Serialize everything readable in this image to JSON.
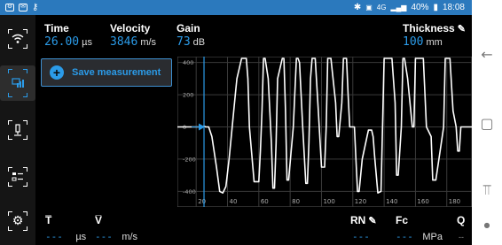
{
  "status_bar": {
    "left_icons": [
      "notification-icon",
      "mail-icon",
      "key-icon"
    ],
    "network": "4G",
    "battery": "40%",
    "time": "18:08"
  },
  "header": {
    "time": {
      "label": "Time",
      "value": "26.00",
      "unit": "µs"
    },
    "velocity": {
      "label": "Velocity",
      "value": "3846",
      "unit": "m/s"
    },
    "gain": {
      "label": "Gain",
      "value": "73",
      "unit": "dB"
    },
    "thickness": {
      "label": "Thickness",
      "value": "100",
      "unit": "mm"
    }
  },
  "save_button": {
    "label": "Save measurement"
  },
  "sidebar": {
    "items": [
      "wifi-icon",
      "ascan-view-icon",
      "probe-icon",
      "settings-list-icon",
      "gear-icon"
    ],
    "active_index": 1
  },
  "chart_data": {
    "type": "line",
    "xlabel": "",
    "ylabel": "",
    "xlim": [
      8,
      196
    ],
    "ylim": [
      -420,
      420
    ],
    "x_ticks": [
      "20",
      "40",
      "60",
      "80",
      "100",
      "120",
      "140",
      "160",
      "180"
    ],
    "y_ticks": [
      "400",
      "200",
      "0",
      "-200",
      "-400"
    ],
    "grid": true,
    "gate_x": 25,
    "series": [
      {
        "color": "#ffffff",
        "x": [
          8,
          22,
          24,
          25,
          26,
          28,
          30,
          33,
          35,
          37,
          39,
          41,
          43,
          45,
          46,
          49,
          52,
          53,
          54,
          57,
          60,
          61,
          62,
          63,
          64,
          66,
          68,
          69,
          70,
          71,
          72,
          75,
          76,
          77,
          78,
          79,
          82,
          84,
          85,
          86,
          88,
          90,
          91,
          92,
          93,
          94,
          96,
          98,
          100,
          102,
          103,
          104,
          106,
          109,
          110,
          111,
          113,
          114,
          116,
          117,
          118,
          121,
          122,
          123,
          124,
          126,
          130,
          132,
          133,
          134,
          136,
          138,
          139,
          140,
          142,
          145,
          147,
          148,
          149,
          151,
          152,
          153,
          155,
          158,
          159,
          160,
          162,
          165,
          167,
          168,
          170,
          171,
          173,
          178,
          179,
          180,
          182,
          184,
          186,
          187,
          188,
          189,
          190,
          191,
          192,
          196
        ],
        "y": [
          0,
          0,
          0,
          5,
          0,
          0,
          -60,
          -250,
          -400,
          -410,
          -370,
          -200,
          0,
          200,
          300,
          520,
          520,
          300,
          0,
          -340,
          -340,
          -150,
          100,
          520,
          520,
          300,
          -100,
          -380,
          -380,
          -100,
          300,
          520,
          520,
          100,
          -330,
          -330,
          0,
          520,
          520,
          400,
          0,
          -350,
          -350,
          -100,
          300,
          520,
          520,
          100,
          -250,
          -250,
          0,
          520,
          520,
          150,
          -60,
          -60,
          150,
          520,
          520,
          200,
          0,
          0,
          -200,
          -400,
          -400,
          -200,
          -20,
          -20,
          -60,
          -190,
          -410,
          -400,
          0,
          520,
          520,
          520,
          150,
          -300,
          -300,
          0,
          520,
          520,
          300,
          0,
          0,
          520,
          520,
          520,
          0,
          -20,
          -60,
          -330,
          -330,
          0,
          520,
          520,
          520,
          100,
          0,
          -150,
          -150,
          0,
          0,
          0,
          0,
          0
        ]
      }
    ]
  },
  "footer": {
    "mean_t": {
      "label": "T̅",
      "value": "---",
      "unit": "µs"
    },
    "mean_v": {
      "label": "V̅",
      "value": "---",
      "unit": "m/s"
    },
    "rn": {
      "label": "RN",
      "value": "---"
    },
    "fc": {
      "label": "Fc",
      "value": "---",
      "unit": "MPa"
    },
    "q": {
      "label": "Q",
      "value": "--"
    }
  },
  "colors": {
    "accent": "#2b9be8",
    "status_bar": "#2b79bd",
    "background": "#000000",
    "sidebar": "#151515"
  },
  "nav_buttons": [
    "back-icon",
    "recents-icon",
    "switch-icon",
    "dot-icon"
  ]
}
